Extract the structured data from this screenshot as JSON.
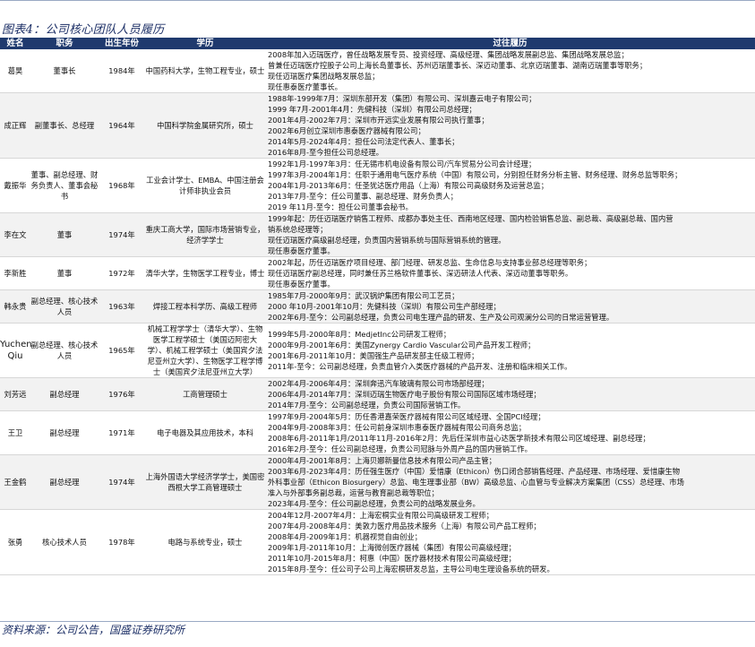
{
  "caption": "图表4：公司核心团队人员履历",
  "headers": {
    "name": "姓名",
    "title": "职务",
    "birth": "出生年份",
    "edu": "学历",
    "exp": "过往履历"
  },
  "rows": [
    {
      "name": "葛昊",
      "title": "董事长",
      "birth": "1984年",
      "edu": "中国药科大学，生物工程专业，硕士",
      "exp": [
        "2008年加入迈瑞医疗，曾任战略发展专员、投资经理、高级经理、集团战略发展副总监、集团战略发展总监；",
        "曾兼任迈瑞医疗控股子公司上海长岛董事长、苏州迈瑞董事长、深迈动董事、北京迈瑞董事、湖南迈瑞董事等职务；",
        "现任迈瑞医疗集团战略发展总监；",
        "现任惠泰医疗董事长。"
      ]
    },
    {
      "name": "成正辉",
      "title": "副董事长、总经理",
      "birth": "1964年",
      "edu": "中国科学院金属研究所，硕士",
      "exp": [
        "1988年-1999年7月：深圳东部开发（集团）有限公司、深圳嘉云电子有限公司；",
        "1999 年7月-2001年4月：先健科技（深圳）有限公司总经理；",
        "2001年4月-2002年7月：深圳市开远实业发展有限公司执行董事；",
        "2002年6月创立深圳市惠泰医疗器械有限公司；",
        "2014年5月-2024年4月：担任公司法定代表人、董事长；",
        "2016年8月-至今担任公司总经理。"
      ]
    },
    {
      "name": "戴振华",
      "title": "董事、副总经理、财务负责人、董事会秘书",
      "birth": "1968年",
      "edu": "工业会计学士、EMBA、中国注册会计师非执业会员",
      "exp": [
        "1992年1月-1997年3月：任无锡市机电设备有限公司/汽车贸易分公司会计经理；",
        "1997年3月-2004年1月：任职于通用电气医疗系统（中国）有限公司，分别担任财务分析主管、财务经理、财务总监等职务；",
        "2004年1月-2013年6月：任圣犹达医疗用品（上海）有限公司高级财务及运营总监；",
        "2013年7月-至今：任公司董事、副总经理、财务负责人；",
        "2019 年11月-至今：担任公司董事会秘书。"
      ]
    },
    {
      "name": "李在文",
      "title": "董事",
      "birth": "1974年",
      "edu": "重庆工商大学，国际市场营销专业，经济学学士",
      "exp": [
        "1999年起：历任迈瑞医疗销售工程师、成都办事处主任、西南地区经理、国内检验销售总监、副总裁、高级副总裁、国内营",
        "销系统总经理等；",
        "现任迈瑞医疗高级副总经理，负责国内营销系统与国际营销系统的管理。",
        "现任惠泰医疗董事。"
      ]
    },
    {
      "name": "李新胜",
      "title": "董事",
      "birth": "1972年",
      "edu": "清华大学，生物医学工程专业，博士",
      "exp": [
        "2002年起，历任迈瑞医疗项目经理、部门经理、研发总监、生命信息与支持事业部总经理等职务；",
        "现任迈瑞医疗副总经理，同时兼任苏兰格软件董事长、深迈研法人代表、深迈动董事等职务。",
        "现任惠泰医疗董事。"
      ]
    },
    {
      "name": "韩永贵",
      "title": "副总经理、核心技术人员",
      "birth": "1963年",
      "edu": "焊接工程本科学历、高级工程师",
      "exp": [
        "1985年7月-2000年9月：武汉锅炉集团有限公司工艺员；",
        "2000 年10月-2001年10月：先健科技（深圳）有限公司生产部经理；",
        "2002年6月-至今：公司副总经理，负责公司电生理产品的研发、生产及公司观澜分公司的日常运营管理。"
      ]
    },
    {
      "name": "Yuchen Qiu",
      "title": "副总经理、核心技术人员",
      "birth": "1965年",
      "edu": "机械工程学学士（清华大学）、生物医学工程学硕士（美国迈阿密大学）、机械工程学硕士（美国宾夕法尼亚州立大学）、生物医学工程学博士（美国宾夕法尼亚州立大学）",
      "exp": [
        "1999年5月-2000年8月：MedjetInc公司研发工程师；",
        "2000年9月-2001年6月：美国Zynergy Cardio Vascular公司产品开发工程师；",
        "2001年6月-2011年10月：美国强生产品研发部主任级工程师；",
        "2011年-至今：公司副总经理，负责血管介入类医疗器械的产品开发、注册和临床相关工作。"
      ]
    },
    {
      "name": "刘芳远",
      "title": "副总经理",
      "birth": "1976年",
      "edu": "工商管理硕士",
      "exp": [
        "2002年4月-2006年4月：深圳奔迅汽车玻璃有限公司市场部经理；",
        "2006年4月-2014年7月：深圳迈瑞生物医疗电子股份有限公司国际区域市场经理；",
        "2014年7月-至今：公司副总经理，负责公司国际营销工作。"
      ]
    },
    {
      "name": "王卫",
      "title": "副总经理",
      "birth": "1971年",
      "edu": "电子电器及其应用技术，本科",
      "exp": [
        "1997年9月-2004年5月：历任香港嘉荣医疗器械有限公司区域经理、全国PCI经理；",
        "2004年9月-2008年3月：任公司前身深圳市惠泰医疗器械有限公司商务总监；",
        "2008年6月-2011年1月/2011年11月-2016年2月：先后任深圳市益心达医学新技术有限公司区域经理、副总经理；",
        "2016年2月-至今：任公司副总经理，负责公司冠脉与外周产品的国内营销工作。"
      ]
    },
    {
      "name": "王金鹤",
      "title": "副总经理",
      "birth": "1974年",
      "edu": "上海外国语大学经济学学士，美国密西根大学工商管理硕士",
      "exp": [
        "2000年4月-2001年8月：上海贝娜新曼信息技术有限公司产品主管；",
        "2003年6月-2023年4月：历任强生医疗（中国）爱惜康（Ethicon）伤口闭合部销售经理、产品经理、市场经理、爱惜康生物",
        "外科事业部（Ethicon Biosurgery）总监、电生理事业部（BW）高级总监、心血管与专业解决方案集团（CSS）总经理、市场",
        "准入与外部事务副总裁，运营与教育副总裁等职位；",
        "2023年4月-至今：任公司副总经理，负责公司的战略发展业务。"
      ]
    },
    {
      "name": "张勇",
      "title": "核心技术人员",
      "birth": "1978年",
      "edu": "电路与系统专业，硕士",
      "exp": [
        "2004年12月-2007年4月：上海宏桐实业有限公司高级研发工程师；",
        "2007年4月-2008年4月：美敦力医疗用品技术服务（上海）有限公司产品工程师；",
        "2008年4月-2009年1月：机器视觉自由创业；",
        "2009年1月-2011年10月：上海微创医疗器械（集团）有限公司高级经理；",
        "2011年10月-2015年8月：柯惠（中国）医疗器材技术有限公司高级经理；",
        "2015年8月-至今：任公司子公司上海宏桐研发总监，主导公司电生理设备系统的研发。"
      ]
    }
  ],
  "source": "资料来源：公司公告，国盛证券研究所"
}
